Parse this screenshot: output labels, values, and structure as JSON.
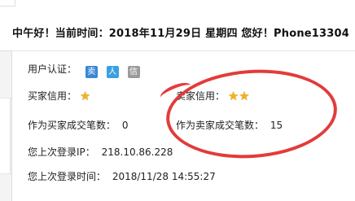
{
  "header": {
    "greeting": "中午好！当前时间：2018年11月29日 星期四 您好！Phone13304"
  },
  "profile": {
    "auth_label": "用户认证：",
    "auth_badges": [
      {
        "name": "seller-auth-badge",
        "text": "卖",
        "color": "#3b86d6"
      },
      {
        "name": "person-auth-badge",
        "text": "人",
        "color": "#3aa0e0"
      },
      {
        "name": "credit-auth-badge",
        "text": "信",
        "color": "#9b9b9b"
      }
    ],
    "buyer_credit_label": "买家信用：",
    "buyer_stars": "★",
    "seller_credit_label": "卖家信用：",
    "seller_stars": "★★",
    "buyer_deals_label": "作为买家成交笔数：",
    "buyer_deals": "0",
    "seller_deals_label": "作为卖家成交笔数：",
    "seller_deals": "15",
    "last_ip_label": "您上次登录IP：",
    "last_ip": "218.10.86.228",
    "last_time_label": "您上次登录时间：",
    "last_time": "2018/11/28 14:55:27"
  },
  "colors": {
    "circle": "#e33b3b",
    "star": "#f2b21b"
  }
}
